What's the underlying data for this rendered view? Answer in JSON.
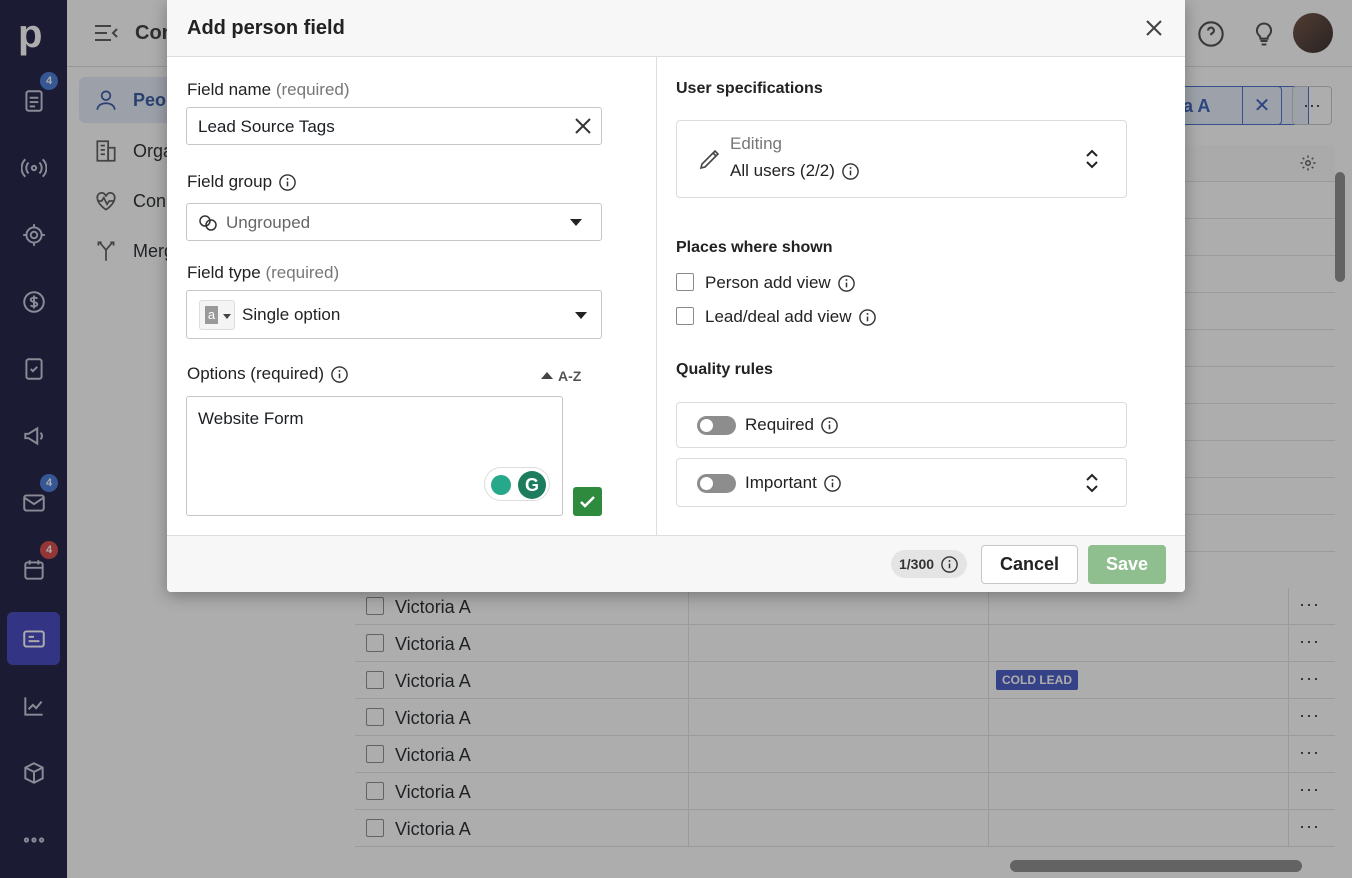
{
  "rail": {
    "logo": "p",
    "badges": {
      "deals": "4",
      "mail": "4",
      "calendar": "4"
    }
  },
  "subnav": {
    "items": [
      {
        "label": "Peo",
        "icon": "person-icon"
      },
      {
        "label": "Orga",
        "icon": "building-icon"
      },
      {
        "label": "Con",
        "icon": "heart-pulse-icon"
      },
      {
        "label": "Merg",
        "icon": "merge-icon"
      }
    ],
    "header_title": "Con"
  },
  "topbar": {
    "filter_label": "a A"
  },
  "grid": {
    "rows": [
      {
        "name": "Victoria A",
        "tag": ""
      },
      {
        "name": "Victoria A",
        "tag": ""
      },
      {
        "name": "Victoria A",
        "tag": "COLD LEAD"
      },
      {
        "name": "Victoria A",
        "tag": ""
      },
      {
        "name": "Victoria A",
        "tag": ""
      },
      {
        "name": "Victoria A",
        "tag": ""
      },
      {
        "name": "Victoria A",
        "tag": ""
      }
    ]
  },
  "modal": {
    "title": "Add person field",
    "field_name": {
      "label": "Field name",
      "req": "(required)",
      "value": "Lead Source Tags"
    },
    "field_group": {
      "label": "Field group",
      "value": "Ungrouped"
    },
    "field_type": {
      "label": "Field type",
      "req": "(required)",
      "value": "Single option",
      "icon_letter": "a"
    },
    "options": {
      "label": "Options (required)",
      "sort_label": "A-Z",
      "value": "Website Form"
    },
    "user_spec": {
      "title": "User specifications",
      "mode": "Editing",
      "users": "All users (2/2)"
    },
    "places": {
      "title": "Places where shown",
      "items": [
        "Person add view",
        "Lead/deal add view"
      ]
    },
    "quality": {
      "title": "Quality rules",
      "required": "Required",
      "important": "Important"
    },
    "footer": {
      "counter": "1/300",
      "cancel": "Cancel",
      "save": "Save"
    }
  },
  "colors": {
    "rail": "#14153d",
    "save": "#8fbe8f",
    "confirm": "#2e8b3e",
    "tag": "#3e53c2"
  }
}
